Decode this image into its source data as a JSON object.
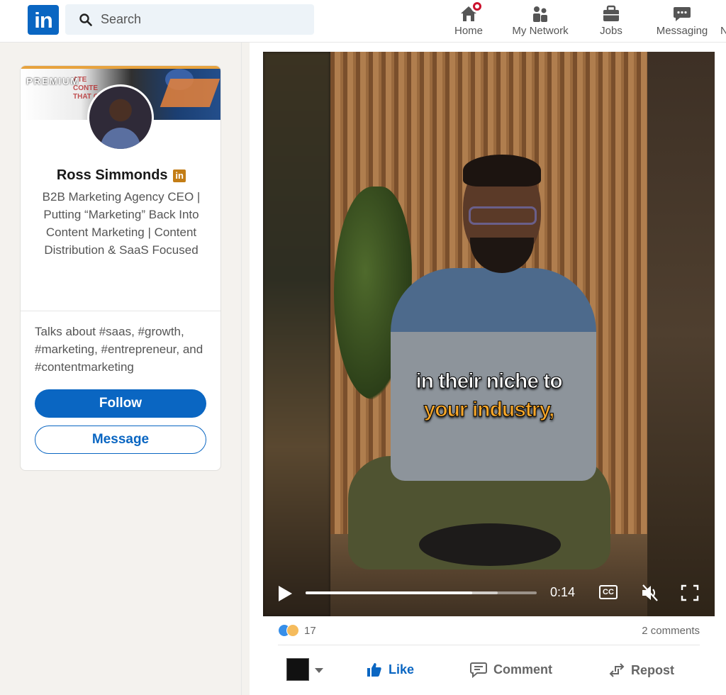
{
  "nav": {
    "logo_text": "in",
    "search_placeholder": "Search",
    "items": [
      {
        "label": "Home"
      },
      {
        "label": "My Network"
      },
      {
        "label": "Jobs"
      },
      {
        "label": "Messaging"
      }
    ],
    "partial_item": "N"
  },
  "profile": {
    "premium_label": "PREMIUM",
    "cover_text": "ATE CONTE THAT CU",
    "name": "Ross Simmonds",
    "headline": "B2B Marketing Agency CEO | Putting “Marketing” Back Into Content Marketing | Content Distribution & SaaS Focused",
    "talks_about": "Talks about #saas, #growth, #marketing, #entrepreneur, and #contentmarketing",
    "follow_label": "Follow",
    "message_label": "Message"
  },
  "video": {
    "caption_line1": "in their niche to",
    "caption_line2": "your industry,",
    "time": "0:14",
    "progress": 0.72,
    "buffered": 0.83,
    "cc_label": "CC"
  },
  "post": {
    "reaction_count": "17",
    "comments": "2 comments",
    "actions": {
      "like": "Like",
      "comment": "Comment",
      "repost": "Repost"
    }
  },
  "colors": {
    "brand": "#0a66c2",
    "caption_accent": "#f7a72a",
    "premium_badge": "#c37d16",
    "notification": "#cb112d"
  }
}
